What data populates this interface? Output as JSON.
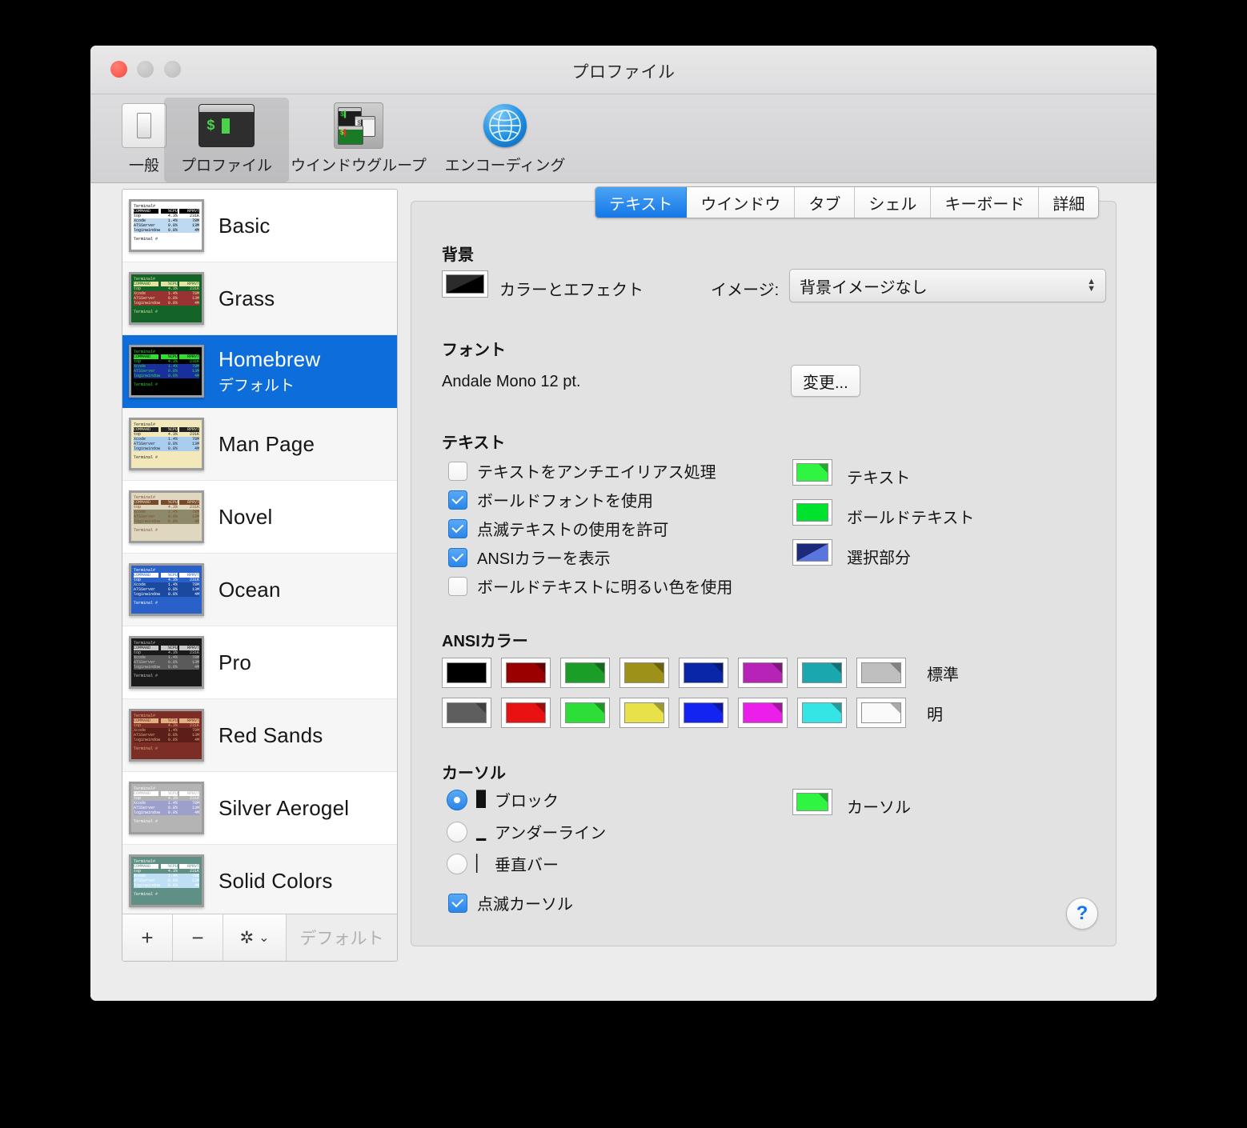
{
  "window": {
    "title": "プロファイル"
  },
  "toolbar": {
    "items": [
      {
        "label": "一般",
        "icon": "general-toggle-icon",
        "selected": false
      },
      {
        "label": "プロファイル",
        "icon": "terminal-icon",
        "selected": true
      },
      {
        "label": "ウインドウグループ",
        "icon": "window-group-icon",
        "selected": false
      },
      {
        "label": "エンコーディング",
        "icon": "globe-icon",
        "selected": false
      }
    ]
  },
  "sidebar": {
    "profiles": [
      {
        "name": "Basic",
        "subtitle": "",
        "selected": false,
        "bg": "#ffffff",
        "fg": "#000000",
        "accent": "#bed9f2"
      },
      {
        "name": "Grass",
        "subtitle": "",
        "selected": false,
        "bg": "#14642a",
        "fg": "#e3e3a0",
        "accent": "#993333"
      },
      {
        "name": "Homebrew",
        "subtitle": "デフォルト",
        "selected": true,
        "bg": "#000000",
        "fg": "#2ee02e",
        "accent": "#1a2f9e"
      },
      {
        "name": "Man Page",
        "subtitle": "",
        "selected": false,
        "bg": "#f2e8ba",
        "fg": "#222222",
        "accent": "#a8cdee"
      },
      {
        "name": "Novel",
        "subtitle": "",
        "selected": false,
        "bg": "#dfd7bf",
        "fg": "#7a4b2a",
        "accent": "#8d8a6b"
      },
      {
        "name": "Ocean",
        "subtitle": "",
        "selected": false,
        "bg": "#2a61c9",
        "fg": "#ffffff",
        "accent": "#1b49a0"
      },
      {
        "name": "Pro",
        "subtitle": "",
        "selected": false,
        "bg": "#1a1a1a",
        "fg": "#c8c8c8",
        "accent": "#5a5a5a"
      },
      {
        "name": "Red Sands",
        "subtitle": "",
        "selected": false,
        "bg": "#7b2d26",
        "fg": "#e0b080",
        "accent": "#5c1e18"
      },
      {
        "name": "Silver Aerogel",
        "subtitle": "",
        "selected": false,
        "bg": "#b4b4b4",
        "fg": "#ffffff",
        "accent": "#9ea0cc"
      },
      {
        "name": "Solid Colors",
        "subtitle": "",
        "selected": false,
        "bg": "#5f8f85",
        "fg": "#ffffff",
        "accent": "#bfe0f4"
      }
    ],
    "thumbnail_text": {
      "prompt_top": "Terminal#",
      "header": [
        "COMMAND",
        "%CPU",
        "RPRVT"
      ],
      "rows": [
        [
          "top",
          "4.3%",
          "231K"
        ],
        [
          "Xcode",
          "1.4%",
          "78M"
        ],
        [
          "ATSServer",
          "0.8%",
          "13M"
        ],
        [
          "loginwindow",
          "0.8%",
          "4M"
        ]
      ],
      "prompt_bottom": "Terminal #"
    },
    "buttons": {
      "add": "+",
      "remove": "−",
      "gear": "gear-icon",
      "gear_chevron": "chevron-down-icon",
      "default": "デフォルト"
    }
  },
  "tabs": [
    {
      "label": "テキスト",
      "active": true
    },
    {
      "label": "ウインドウ",
      "active": false
    },
    {
      "label": "タブ",
      "active": false
    },
    {
      "label": "シェル",
      "active": false
    },
    {
      "label": "キーボード",
      "active": false
    },
    {
      "label": "詳細",
      "active": false
    }
  ],
  "background": {
    "heading": "背景",
    "color_effects_label": "カラーとエフェクト",
    "color": "#121212",
    "image_label": "イメージ:",
    "image_value": "背景イメージなし"
  },
  "font": {
    "heading": "フォント",
    "value": "Andale Mono 12 pt.",
    "change_button": "変更..."
  },
  "text": {
    "heading": "テキスト",
    "checkboxes": [
      {
        "label": "テキストをアンチエイリアス処理",
        "checked": false
      },
      {
        "label": "ボールドフォントを使用",
        "checked": true
      },
      {
        "label": "点滅テキストの使用を許可",
        "checked": true
      },
      {
        "label": "ANSIカラーを表示",
        "checked": true
      },
      {
        "label": "ボールドテキストに明るい色を使用",
        "checked": false
      }
    ],
    "swatches": [
      {
        "label": "テキスト",
        "color": "#2ff442"
      },
      {
        "label": "ボールドテキスト",
        "color": "#00e32e"
      },
      {
        "label": "選択部分",
        "color": "#2a3fa0"
      }
    ]
  },
  "ansi": {
    "heading": "ANSIカラー",
    "normal_label": "標準",
    "bright_label": "明",
    "normal": [
      "#000000",
      "#990000",
      "#1a9e27",
      "#9d9119",
      "#0a26a8",
      "#b623b6",
      "#1aa7ad",
      "#bfbfbf"
    ],
    "bright": [
      "#5e5e5e",
      "#e81212",
      "#2ede38",
      "#e8e248",
      "#1424f0",
      "#ea20ea",
      "#35e5e5",
      "#fafafa"
    ]
  },
  "cursor": {
    "heading": "カーソル",
    "options": [
      {
        "label": "ブロック",
        "glyph": "█",
        "selected": true
      },
      {
        "label": "アンダーライン",
        "glyph": "▁",
        "selected": false
      },
      {
        "label": "垂直バー",
        "glyph": "▏",
        "selected": false
      }
    ],
    "blink": {
      "label": "点滅カーソル",
      "checked": true
    },
    "swatch": {
      "label": "カーソル",
      "color": "#2ff442"
    }
  },
  "help": {
    "label": "?"
  }
}
